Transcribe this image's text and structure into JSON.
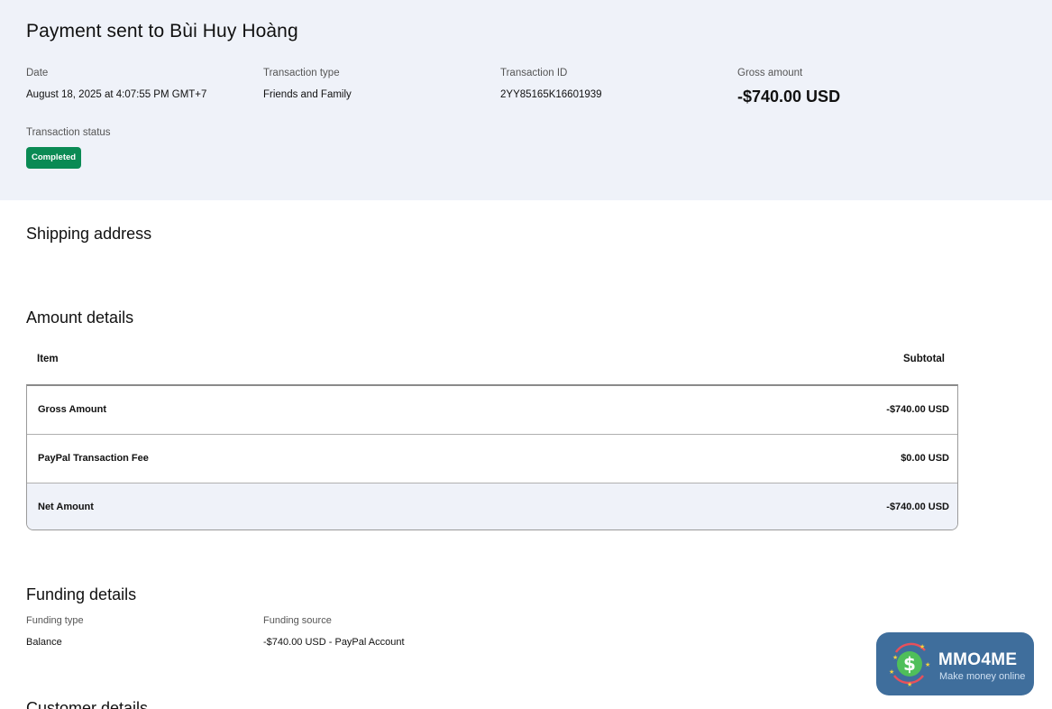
{
  "summary": {
    "title": "Payment sent to Bùi Huy Hoàng",
    "date_label": "Date",
    "date_value": "August 18, 2025 at 4:07:55 PM GMT+7",
    "type_label": "Transaction type",
    "type_value": "Friends and Family",
    "id_label": "Transaction ID",
    "id_value": "2YY85165K16601939",
    "gross_label": "Gross amount",
    "gross_value": "-$740.00 USD",
    "status_label": "Transaction status",
    "status_value": "Completed",
    "status_color": "#0a8a54"
  },
  "shipping": {
    "title": "Shipping address"
  },
  "amount_details": {
    "title": "Amount details",
    "col_item": "Item",
    "col_subtotal": "Subtotal",
    "rows": [
      {
        "label": "Gross Amount",
        "value": "-$740.00 USD"
      },
      {
        "label": "PayPal Transaction Fee",
        "value": "$0.00 USD"
      },
      {
        "label": "Net Amount",
        "value": "-$740.00 USD"
      }
    ]
  },
  "funding": {
    "title": "Funding details",
    "type_label": "Funding type",
    "type_value": "Balance",
    "source_label": "Funding source",
    "source_value": "-$740.00 USD - PayPal Account"
  },
  "customer": {
    "title": "Customer details"
  },
  "watermark": {
    "name": "MMO4ME",
    "tagline": "Make money online",
    "icon": "dollar-coin-icon"
  }
}
